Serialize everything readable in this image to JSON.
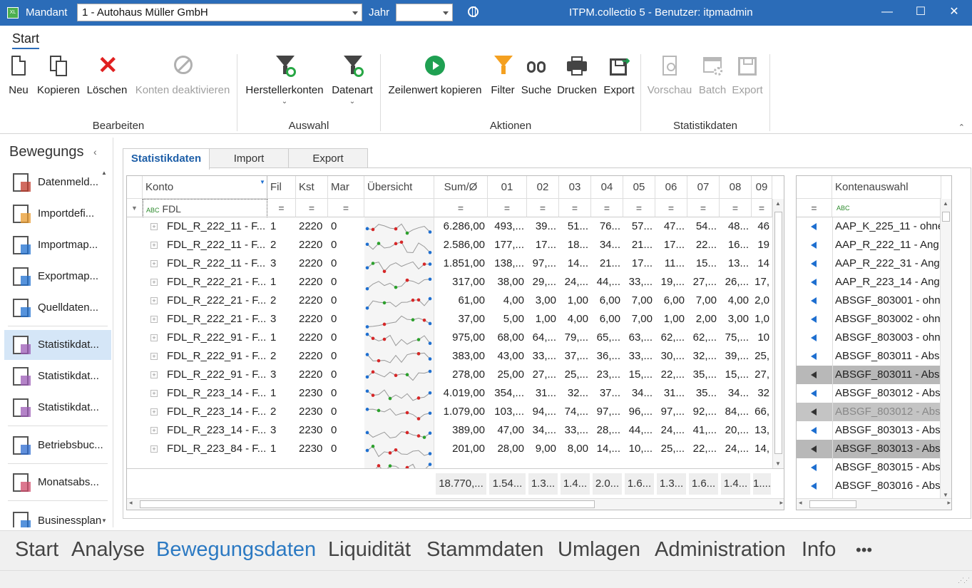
{
  "titlebar": {
    "mandant_label": "Mandant",
    "mandant_value": "1 - Autohaus Müller GmbH",
    "jahr_label": "Jahr",
    "jahr_value": "",
    "title": "ITPM.collectio 5 - Benutzer: itpmadmin",
    "minimize": "—",
    "maximize": "☐",
    "close": "✕"
  },
  "ribbon": {
    "tab": "Start",
    "groups": [
      {
        "label": "Bearbeiten",
        "buttons": [
          "Neu",
          "Kopieren",
          "Löschen",
          "Konten deaktivieren"
        ]
      },
      {
        "label": "Auswahl",
        "buttons": [
          "Herstellerkonten",
          "Datenart"
        ]
      },
      {
        "label": "Aktionen",
        "buttons": [
          "Zeilenwert kopieren",
          "Filter",
          "Suche",
          "Drucken",
          "Export"
        ]
      },
      {
        "label": "Statistikdaten",
        "buttons": [
          "Vorschau",
          "Batch",
          "Export"
        ]
      }
    ]
  },
  "sidebar": {
    "title": "Bewegungs",
    "items": [
      "Datenmeld...",
      "Importdefi...",
      "Importmap...",
      "Exportmap...",
      "Quelldaten...",
      "Statistikdat...",
      "Statistikdat...",
      "Statistikdat...",
      "Betriebsbuc...",
      "Monatsabs...",
      "Businessplan"
    ]
  },
  "tabs": [
    "Statistikdaten",
    "Import",
    "Export"
  ],
  "grid": {
    "headers": [
      "Konto",
      "Fil",
      "Kst",
      "Mar",
      "Übersicht",
      "Sum/Ø",
      "01",
      "02",
      "03",
      "04",
      "05",
      "06",
      "07",
      "08",
      "09"
    ],
    "filter": {
      "konto": "FDL",
      "op": "="
    },
    "rows": [
      [
        "FDL_R_222_11 - F...",
        "1",
        "2220",
        "0",
        "6.286,00",
        "493,...",
        "39...",
        "51...",
        "76...",
        "57...",
        "47...",
        "54...",
        "48...",
        "46"
      ],
      [
        "FDL_R_222_11 - F...",
        "2",
        "2220",
        "0",
        "2.586,00",
        "177,...",
        "17...",
        "18...",
        "34...",
        "21...",
        "17...",
        "22...",
        "16...",
        "19"
      ],
      [
        "FDL_R_222_11 - F...",
        "3",
        "2220",
        "0",
        "1.851,00",
        "138,...",
        "97,...",
        "14...",
        "21...",
        "17...",
        "11...",
        "15...",
        "13...",
        "14"
      ],
      [
        "FDL_R_222_21 - F...",
        "1",
        "2220",
        "0",
        "317,00",
        "38,00",
        "29,...",
        "24,...",
        "44,...",
        "33,...",
        "19,...",
        "27,...",
        "26,...",
        "17,"
      ],
      [
        "FDL_R_222_21 - F...",
        "2",
        "2220",
        "0",
        "61,00",
        "4,00",
        "3,00",
        "1,00",
        "6,00",
        "7,00",
        "6,00",
        "7,00",
        "4,00",
        "2,0"
      ],
      [
        "FDL_R_222_21 - F...",
        "3",
        "2220",
        "0",
        "37,00",
        "5,00",
        "1,00",
        "4,00",
        "6,00",
        "7,00",
        "1,00",
        "2,00",
        "3,00",
        "1,0"
      ],
      [
        "FDL_R_222_91 - F...",
        "1",
        "2220",
        "0",
        "975,00",
        "68,00",
        "64,...",
        "79,...",
        "65,...",
        "63,...",
        "62,...",
        "62,...",
        "75,...",
        "10"
      ],
      [
        "FDL_R_222_91 - F...",
        "2",
        "2220",
        "0",
        "383,00",
        "43,00",
        "33,...",
        "37,...",
        "36,...",
        "33,...",
        "30,...",
        "32,...",
        "39,...",
        "25,"
      ],
      [
        "FDL_R_222_91 - F...",
        "3",
        "2220",
        "0",
        "278,00",
        "25,00",
        "27,...",
        "25,...",
        "23,...",
        "15,...",
        "22,...",
        "35,...",
        "15,...",
        "27,"
      ],
      [
        "FDL_R_223_14 - F...",
        "1",
        "2230",
        "0",
        "4.019,00",
        "354,...",
        "31...",
        "32...",
        "37...",
        "34...",
        "31...",
        "35...",
        "34...",
        "32"
      ],
      [
        "FDL_R_223_14 - F...",
        "2",
        "2230",
        "0",
        "1.079,00",
        "103,...",
        "94,...",
        "74,...",
        "97,...",
        "96,...",
        "97,...",
        "92,...",
        "84,...",
        "66,"
      ],
      [
        "FDL_R_223_14 - F...",
        "3",
        "2230",
        "0",
        "389,00",
        "47,00",
        "34,...",
        "33,...",
        "28,...",
        "44,...",
        "24,...",
        "41,...",
        "20,...",
        "13,"
      ],
      [
        "FDL_R_223_84 - F...",
        "1",
        "2230",
        "0",
        "201,00",
        "28,00",
        "9,00",
        "8,00",
        "14,...",
        "10,...",
        "25,...",
        "22,...",
        "24,...",
        "14,"
      ]
    ],
    "footer": [
      "18.770,...",
      "1.54...",
      "1.3...",
      "1.4...",
      "2.0...",
      "1.6...",
      "1.3...",
      "1.6...",
      "1.4...",
      "1...."
    ]
  },
  "konten": {
    "header": "Kontenauswahl",
    "op": "=",
    "items": [
      "AAP_K_225_11 - ohne",
      "AAP_R_222_11 - Ang",
      "AAP_R_222_31 - Ang",
      "AAP_R_223_14 - Ang",
      "ABSGF_803001 - ohn",
      "ABSGF_803002 - ohn",
      "ABSGF_803003 - ohn",
      "ABSGF_803011 - Abs",
      "ABSGF_803011 - Abs",
      "ABSGF_803012 - Abs",
      "ABSGF_803012 - Abs",
      "ABSGF_803013 - Abs",
      "ABSGF_803013 - Abs",
      "ABSGF_803015 - Abs",
      "ABSGF_803016 - Abs"
    ]
  },
  "bottomnav": [
    "Start",
    "Analyse",
    "Bewegungsdaten",
    "Liquidität",
    "Stammdaten",
    "Umlagen",
    "Administration",
    "Info",
    "•••"
  ]
}
